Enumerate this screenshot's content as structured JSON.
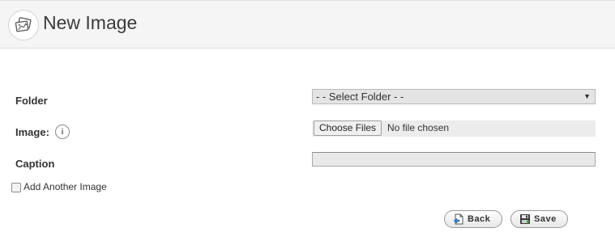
{
  "header": {
    "title": "New Image",
    "icon": "image-icon"
  },
  "form": {
    "folder": {
      "label": "Folder",
      "selected": "- - Select Folder - -"
    },
    "image": {
      "label": "Image:",
      "info_icon": "info-icon",
      "info_glyph": "i",
      "choose_button": "Choose Files",
      "status": "No file chosen"
    },
    "caption": {
      "label": "Caption",
      "value": ""
    },
    "add_another": {
      "label": "Add Another Image",
      "checked": false
    }
  },
  "actions": {
    "back": {
      "label": "Back",
      "icon": "back-document-icon"
    },
    "save": {
      "label": "Save",
      "icon": "save-disk-icon"
    }
  },
  "colors": {
    "header_bg": "#f5f5f5",
    "field_bg": "#e4e4e4",
    "text": "#333333"
  }
}
